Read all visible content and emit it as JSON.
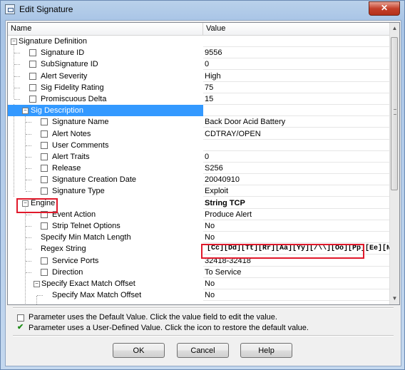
{
  "window": {
    "title": "Edit Signature",
    "close_label": "✕"
  },
  "table": {
    "columns": {
      "name": "Name",
      "value": "Value"
    },
    "rows": [
      {
        "label": "Signature Definition",
        "value": ""
      },
      {
        "label": "Signature ID",
        "value": "9556"
      },
      {
        "label": "SubSignature ID",
        "value": "0"
      },
      {
        "label": "Alert Severity",
        "value": "High"
      },
      {
        "label": "Sig Fidelity Rating",
        "value": "75"
      },
      {
        "label": "Promiscuous Delta",
        "value": "15"
      },
      {
        "label": "Sig Description",
        "value": ""
      },
      {
        "label": "Signature Name",
        "value": "Back Door Acid Battery"
      },
      {
        "label": "Alert Notes",
        "value": "CDTRAY/OPEN"
      },
      {
        "label": "User Comments",
        "value": ""
      },
      {
        "label": "Alert Traits",
        "value": "0"
      },
      {
        "label": "Release",
        "value": "S256"
      },
      {
        "label": "Signature Creation Date",
        "value": "20040910"
      },
      {
        "label": "Signature Type",
        "value": "Exploit"
      },
      {
        "label": "Engine",
        "value": "String TCP"
      },
      {
        "label": "Event Action",
        "value": "Produce Alert"
      },
      {
        "label": "Strip Telnet Options",
        "value": "No"
      },
      {
        "label": "Specify Min Match Length",
        "value": "No"
      },
      {
        "label": "Regex String",
        "value": "[Cc][Dd][Tt][Rr][Aa][Yy][/\\\\][Oo][Pp][Ee][Nn]"
      },
      {
        "label": "Service Ports",
        "value": "32418-32418"
      },
      {
        "label": "Direction",
        "value": "To Service"
      },
      {
        "label": "Specify Exact Match Offset",
        "value": "No"
      },
      {
        "label": "Specify Max Match Offset",
        "value": "No"
      }
    ]
  },
  "legend": {
    "default_text": "Parameter uses the Default Value.  Click the value field to edit the value.",
    "user_text": "Parameter uses a User-Defined Value.  Click the icon to restore the default value."
  },
  "buttons": {
    "ok": "OK",
    "cancel": "Cancel",
    "help": "Help"
  },
  "colors": {
    "selection": "#3399ff",
    "highlight": "#e0192b",
    "user_defined_check": "#1c8b16"
  }
}
